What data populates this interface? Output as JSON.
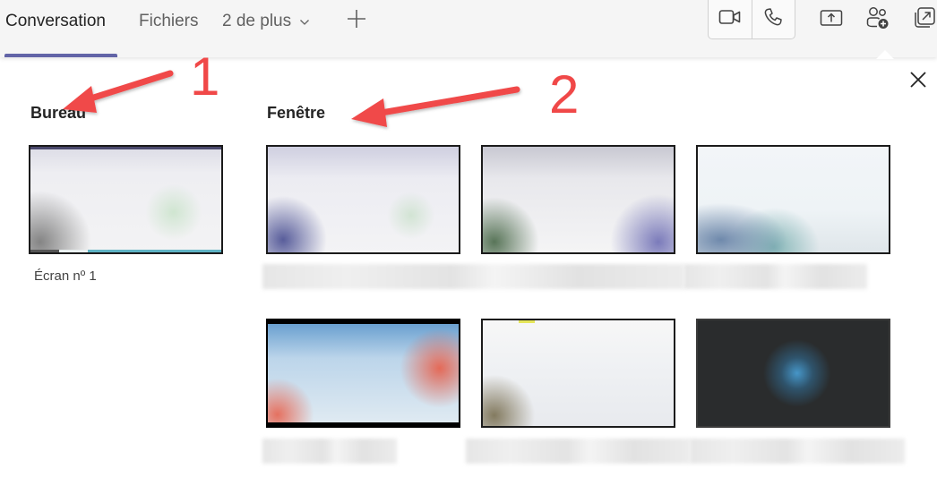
{
  "tabs": {
    "items": [
      {
        "label": "Conversation",
        "active": true
      },
      {
        "label": "Fichiers",
        "active": false
      },
      {
        "label": "2 de plus",
        "active": false
      }
    ],
    "add_tab_icon": "plus-icon",
    "accent_color": "#6264a7"
  },
  "header_actions": [
    {
      "name": "video-call",
      "icon": "video-camera-icon"
    },
    {
      "name": "audio-call",
      "icon": "phone-icon"
    },
    {
      "name": "share-screen",
      "icon": "share-screen-icon"
    },
    {
      "name": "add-people",
      "icon": "add-people-icon"
    },
    {
      "name": "pop-out",
      "icon": "pop-out-icon"
    }
  ],
  "share_panel": {
    "close_icon": "close-icon",
    "desktop_section": {
      "title": "Bureau",
      "screens": [
        {
          "label": "Écran nº 1"
        }
      ]
    },
    "window_section": {
      "title": "Fenêtre",
      "windows_count": 6
    }
  },
  "annotations": [
    {
      "number": "1",
      "color": "#f04848",
      "points_to": "Bureau"
    },
    {
      "number": "2",
      "color": "#f04848",
      "points_to": "Fenêtre"
    }
  ]
}
